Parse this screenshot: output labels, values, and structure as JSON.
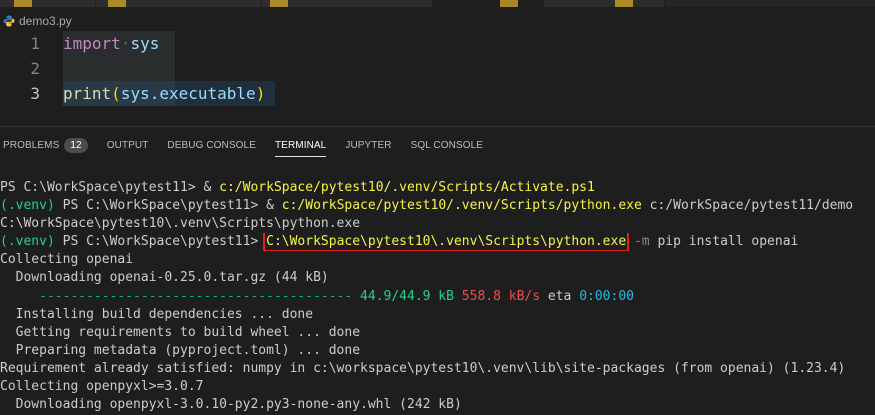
{
  "editor": {
    "filename": "demo3.py",
    "lines": [
      {
        "number": "1",
        "keyword": "import",
        "rest": "sys"
      },
      {
        "number": "2"
      },
      {
        "number": "3",
        "func": "print",
        "arg_obj": "sys",
        "arg_attr": "executable"
      }
    ]
  },
  "panel": {
    "tabs": [
      {
        "label": "PROBLEMS",
        "badge": "12"
      },
      {
        "label": "OUTPUT"
      },
      {
        "label": "DEBUG CONSOLE"
      },
      {
        "label": "TERMINAL"
      },
      {
        "label": "JUPYTER"
      },
      {
        "label": "SQL CONSOLE"
      }
    ]
  },
  "terminal": {
    "l1_prompt": "PS C:\\WorkSpace\\pytest11> & ",
    "l1_cmd": "c:/WorkSpace/pytest10/.venv/Scripts/Activate.ps1",
    "l2_venv": "(.venv)",
    "l2_prompt": " PS C:\\WorkSpace\\pytest11> & ",
    "l2_cmd": "c:/WorkSpace/pytest10/.venv/Scripts/python.exe",
    "l2_rest": " c:/WorkSpace/pytest11/demo",
    "l3": "C:\\WorkSpace\\pytest10\\.venv\\Scripts\\python.exe",
    "l4_venv": "(.venv)",
    "l4_prompt": " PS C:\\WorkSpace\\pytest11> ",
    "l4_cmd": "C:\\WorkSpace\\pytest10\\.venv\\Scripts\\python.exe",
    "l4_flag": " -m",
    "l4_rest": " pip install openai",
    "l5": "Collecting openai",
    "l6": "  Downloading openai-0.25.0.tar.gz (44 kB)",
    "l7_indent": "     ",
    "l7_bar": "----------------------------------------",
    "l7_size": " 44.9/44.9 kB",
    "l7_speed": " 558.8 kB/s",
    "l7_eta": " eta ",
    "l7_time": "0:00:00",
    "l8": "  Installing build dependencies ... done",
    "l9": "  Getting requirements to build wheel ... done",
    "l10": "  Preparing metadata (pyproject.toml) ... done",
    "l11": "Requirement already satisfied: numpy in c:\\workspace\\pytest10\\.venv\\lib\\site-packages (from openai) (1.23.4)",
    "l12": "Collecting openpyxl>=3.0.7",
    "l13": "  Downloading openpyxl-3.0.10-py2.py3-none-any.whl (242 kB)"
  }
}
